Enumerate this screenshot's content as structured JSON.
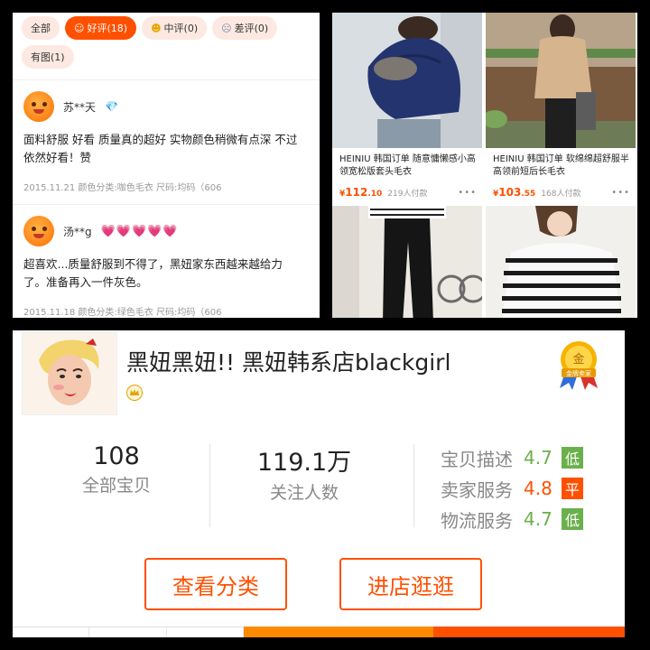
{
  "reviews": {
    "filters": [
      {
        "label": "全部",
        "icon": "",
        "active": false
      },
      {
        "label": "好评(18)",
        "icon": "smile-icon",
        "active": true
      },
      {
        "label": "中评(0)",
        "icon": "neutral-icon",
        "active": false
      },
      {
        "label": "差评(0)",
        "icon": "frown-icon",
        "active": false
      },
      {
        "label": "有图(1)",
        "icon": "",
        "active": false
      }
    ],
    "items": [
      {
        "user": "苏**天",
        "badge": "💎",
        "text": "面料舒服 好看 质量真的超好 实物颜色稍微有点深 不过依然好看！赞",
        "meta": "2015.11.21 颜色分类:咖色毛衣 尺码:均码（606"
      },
      {
        "user": "汤**g",
        "badge": "💗💗💗💗💗",
        "text": "超喜欢...质量舒服到不得了，黑妞家东西越来越给力了。准备再入一件灰色。",
        "meta": "2015.11.18 颜色分类:绿色毛衣 尺码:均码（606"
      }
    ]
  },
  "products": [
    {
      "title": "HEINIU 韩国订单  随意慵懒感小高领宽松版套头毛衣",
      "price_symbol": "¥",
      "price_int": "112",
      "price_dec": ".10",
      "sold": "219人付款",
      "more": "•••"
    },
    {
      "title": "HEINIU 韩国订单  软绵绵超舒服半高领前短后长毛衣",
      "price_symbol": "¥",
      "price_int": "103",
      "price_dec": ".55",
      "sold": "168人付款",
      "more": "•••"
    },
    {
      "title": "",
      "price_symbol": "",
      "price_int": "",
      "price_dec": "",
      "sold": "",
      "more": ""
    },
    {
      "title": "",
      "price_symbol": "",
      "price_int": "",
      "price_dec": "",
      "sold": "",
      "more": ""
    }
  ],
  "shop": {
    "name": "黑妞黑妞!!  黑妞韩系店blackgirl",
    "gold_badge_text": "金",
    "gold_badge_sub": "金牌卖家",
    "stats": [
      {
        "num": "108",
        "label": "全部宝贝"
      },
      {
        "num": "119.1万",
        "label": "关注人数"
      }
    ],
    "scores": [
      {
        "label": "宝贝描述",
        "value": "4.7",
        "tag": "低",
        "color": "#6ab04c"
      },
      {
        "label": "卖家服务",
        "value": "4.8",
        "tag": "平",
        "color": "#ff5000"
      },
      {
        "label": "物流服务",
        "value": "4.7",
        "tag": "低",
        "color": "#6ab04c"
      }
    ],
    "buttons": {
      "category": "查看分类",
      "enter": "进店逛逛"
    }
  },
  "colors": {
    "accent": "#ff5000",
    "green": "#6ab04c",
    "chip_bg": "#fde9e1"
  }
}
